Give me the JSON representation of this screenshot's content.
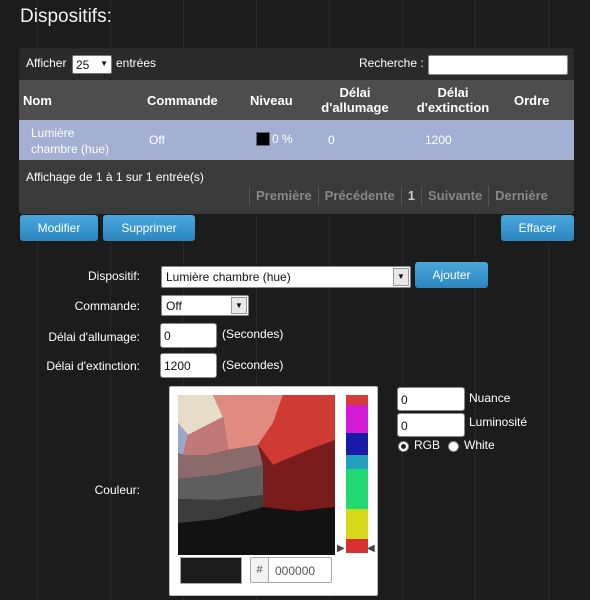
{
  "page_title": "Dispositifs:",
  "datatable": {
    "show_label": "Afficher",
    "page_length": "25",
    "entries_label": "entrées",
    "search_label": "Recherche :",
    "search_value": "",
    "columns": [
      "Nom",
      "Commande",
      "Niveau",
      "Délai\nd'allumage",
      "Délai\nd'extinction",
      "Ordre"
    ],
    "rows": [
      {
        "name": "Lumière\nchambre (hue)",
        "command": "Off",
        "level": "0 %",
        "on_delay": "0",
        "off_delay": "1200",
        "order": ""
      }
    ],
    "info": "Affichage de 1 à 1 sur 1 entrée(s)",
    "pager": {
      "first": "Première",
      "previous": "Précédente",
      "page": "1",
      "next": "Suivante",
      "last": "Dernière"
    }
  },
  "buttons": {
    "modify": "Modifier",
    "delete": "Supprimer",
    "clear": "Effacer",
    "add": "Ajouter"
  },
  "form": {
    "device_label": "Dispositif:",
    "device_value": "Lumière chambre (hue)",
    "command_label": "Commande:",
    "command_value": "Off",
    "on_delay_label": "Délai d'allumage:",
    "on_delay_value": "0",
    "off_delay_label": "Délai d'extinction:",
    "off_delay_value": "1200",
    "seconds_unit": "(Secondes)",
    "color_label": "Couleur:"
  },
  "color_picker": {
    "hue_value": "0",
    "hue_label": "Nuance",
    "brightness_value": "0",
    "brightness_label": "Luminosité",
    "mode_rgb_label": "RGB",
    "mode_white_label": "White",
    "mode_selected": "RGB",
    "hex_value": "000000",
    "selected_color": "#1c1c1c"
  },
  "colors": {
    "accent": "#3598d0",
    "selected_row": "#a3b0d3",
    "header": "#4d4d4d"
  },
  "icons": [
    "dropdown-arrow-icon",
    "color-swatch-icon",
    "hue-slider-arrow-icon"
  ]
}
